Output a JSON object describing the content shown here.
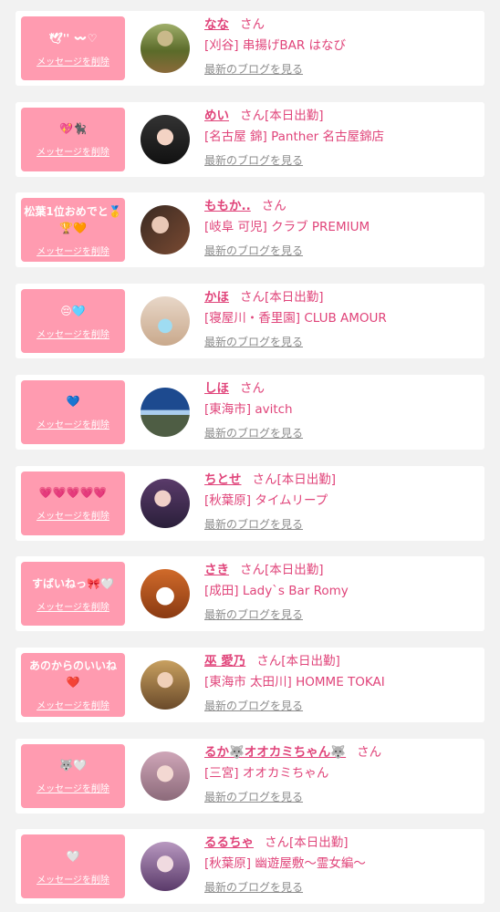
{
  "delete_label": "メッセージを削除",
  "blog_label": "最新のブログを見る",
  "san_label": "さん",
  "colors": {
    "background": "#f2f2f2",
    "card": "#ffffff",
    "pink_button": "#ff9bb0",
    "accent": "#e0447a",
    "link_gray": "#8c8c8c"
  },
  "rows": [
    {
      "message": "🕊'' 〰♡",
      "name": "なな",
      "status": "",
      "shop": "[刈谷] 串揚げBAR はなび",
      "avatar_icon": "person-outdoor-avatar"
    },
    {
      "message": "💖🐈‍⬛",
      "name": "めい",
      "status": "[本日出勤]",
      "shop": "[名古屋 錦] Panther 名古屋錦店",
      "avatar_icon": "woman-avatar"
    },
    {
      "message": "松葉1位おめでと🥇🏆🧡",
      "name": "ももか..",
      "status": "",
      "shop": "[岐阜 可児] クラブ PREMIUM",
      "avatar_icon": "woman-avatar"
    },
    {
      "message": "😔🩵",
      "name": "かほ",
      "status": "[本日出勤]",
      "shop": "[寝屋川・香里園] CLUB AMOUR",
      "avatar_icon": "woman-avatar"
    },
    {
      "message": "💙",
      "name": "しほ",
      "status": "",
      "shop": "[東海市] avitch",
      "avatar_icon": "mountain-avatar"
    },
    {
      "message": "💗💗💗💗💗",
      "name": "ちとせ",
      "status": "[本日出勤]",
      "shop": "[秋葉原] タイムリープ",
      "avatar_icon": "woman-avatar"
    },
    {
      "message": "すばいねっ🎀🤍",
      "name": "さき",
      "status": "[本日出勤]",
      "shop": "[成田] Lady`s Bar Romy",
      "avatar_icon": "bunny-avatar"
    },
    {
      "message": "あのからのいいね❤️",
      "name": "巫 愛乃",
      "status": "[本日出勤]",
      "shop": "[東海市 太田川] HOMME TOKAI",
      "avatar_icon": "woman-avatar"
    },
    {
      "message": "🐺🤍",
      "name": "るか🐺オオカミちゃん🐺",
      "status": "",
      "shop": "[三宮] オオカミちゃん",
      "avatar_icon": "woman-avatar"
    },
    {
      "message": "🤍",
      "name": "るるちゃ",
      "status": "[本日出勤]",
      "shop": "[秋葉原] 幽遊屋敷〜霊女編〜",
      "avatar_icon": "woman-avatar"
    }
  ]
}
